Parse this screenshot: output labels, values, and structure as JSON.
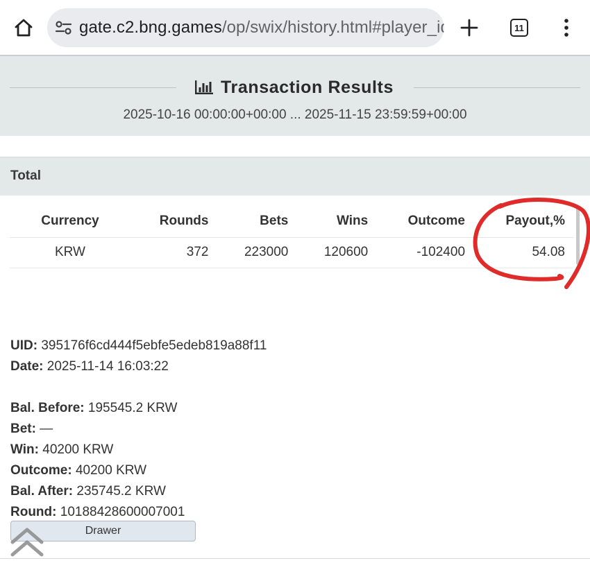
{
  "browser": {
    "url_host": "gate.c2.bng.games",
    "url_path": "/op/swix/history.html#player_id",
    "tab_count": "11",
    "icons": {
      "home": "home-icon",
      "site_settings": "tune-icon",
      "new_tab": "plus-icon",
      "tabs": "tab-switcher-icon",
      "menu": "more-vert-icon"
    }
  },
  "header": {
    "title": "Transaction Results",
    "icon": "bar-chart-icon",
    "date_range": "2025-10-16 00:00:00+00:00 ... 2025-11-15 23:59:59+00:00"
  },
  "total": {
    "label": "Total",
    "columns": [
      "Currency",
      "Rounds",
      "Bets",
      "Wins",
      "Outcome",
      "Payout,%"
    ],
    "rows": [
      [
        "KRW",
        "372",
        "223000",
        "120600",
        "-102400",
        "54.08"
      ]
    ]
  },
  "transaction": {
    "uid_label": "UID:",
    "uid": "395176f6cd444f5ebfe5edeb819a88f11",
    "date_label": "Date:",
    "date": "2025-11-14 16:03:22",
    "bal_before_label": "Bal. Before:",
    "bal_before": "195545.2 KRW",
    "bet_label": "Bet:",
    "bet": "—",
    "win_label": "Win:",
    "win": "40200 KRW",
    "outcome_label": "Outcome:",
    "outcome": "40200 KRW",
    "bal_after_label": "Bal. After:",
    "bal_after": "235745.2 KRW",
    "round_label": "Round:",
    "round": "10188428600007001",
    "drawer_label": "Drawer"
  },
  "colors": {
    "header_band": "#e3e8e8",
    "annotation_red": "#e02b2b",
    "omnibox": "#e9ebef"
  }
}
